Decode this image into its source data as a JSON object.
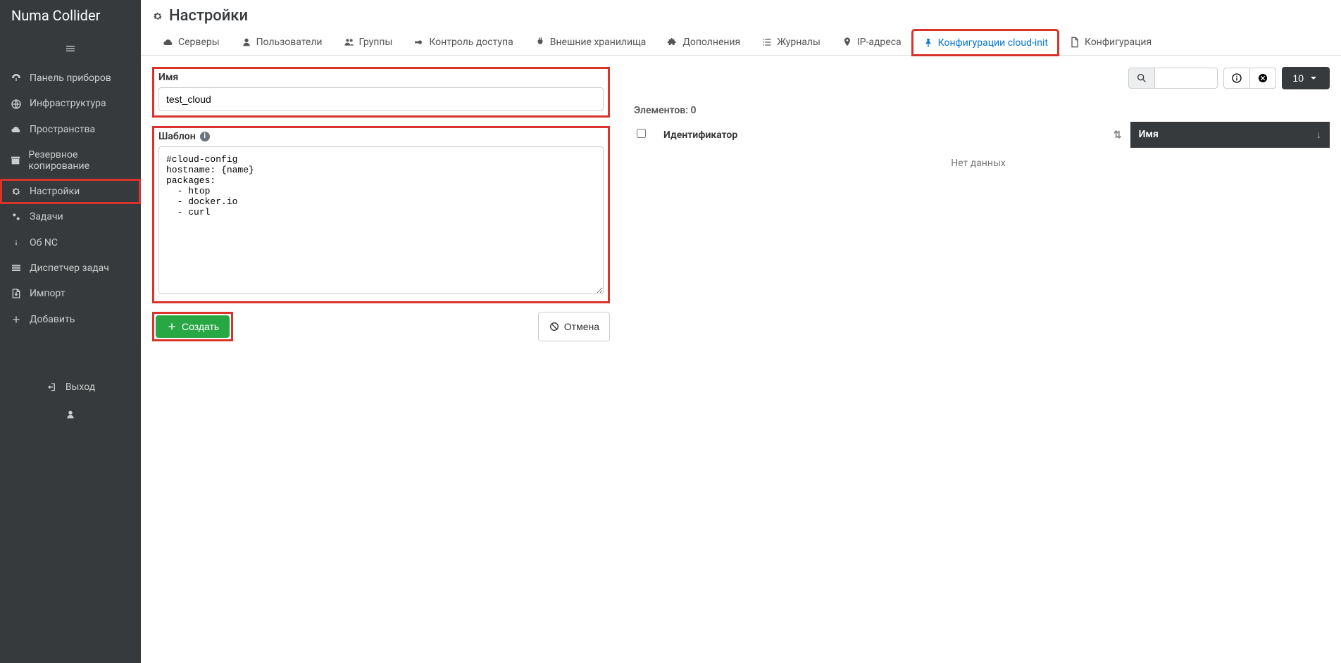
{
  "brand": "Numa Collider",
  "sidebar": {
    "items": [
      {
        "icon": "dashboard",
        "label": "Панель приборов"
      },
      {
        "icon": "globe",
        "label": "Инфраструктура"
      },
      {
        "icon": "cloud",
        "label": "Пространства"
      },
      {
        "icon": "archive",
        "label": "Резервное копирование"
      },
      {
        "icon": "gear",
        "label": "Настройки",
        "active": true
      },
      {
        "icon": "gears",
        "label": "Задачи"
      },
      {
        "icon": "info",
        "label": "Об NC"
      },
      {
        "icon": "tasks",
        "label": "Диспетчер задач"
      },
      {
        "icon": "import",
        "label": "Импорт"
      },
      {
        "icon": "plus",
        "label": "Добавить"
      }
    ],
    "logout": "Выход"
  },
  "page": {
    "title": "Настройки"
  },
  "tabs": [
    {
      "icon": "cloud",
      "label": "Серверы"
    },
    {
      "icon": "user",
      "label": "Пользователи"
    },
    {
      "icon": "group",
      "label": "Группы"
    },
    {
      "icon": "key",
      "label": "Контроль доступа"
    },
    {
      "icon": "plug",
      "label": "Внешние хранилища"
    },
    {
      "icon": "puzzle",
      "label": "Дополнения"
    },
    {
      "icon": "list",
      "label": "Журналы"
    },
    {
      "icon": "pin",
      "label": "IP-адреса"
    },
    {
      "icon": "pin-solid",
      "label": "Конфигурации cloud-init",
      "active": true
    },
    {
      "icon": "file",
      "label": "Конфигурация"
    }
  ],
  "form": {
    "name_label": "Имя",
    "name_value": "test_cloud",
    "template_label": "Шаблон",
    "template_value": "#cloud-config\nhostname: {name}\npackages:\n  - htop\n  - docker.io\n  - curl",
    "create_btn": "Создать",
    "cancel_btn": "Отмена"
  },
  "list": {
    "count_label": "Элементов: 0",
    "page_size": "10",
    "col_id": "Идентификатор",
    "col_name": "Имя",
    "nodata": "Нет данных"
  }
}
